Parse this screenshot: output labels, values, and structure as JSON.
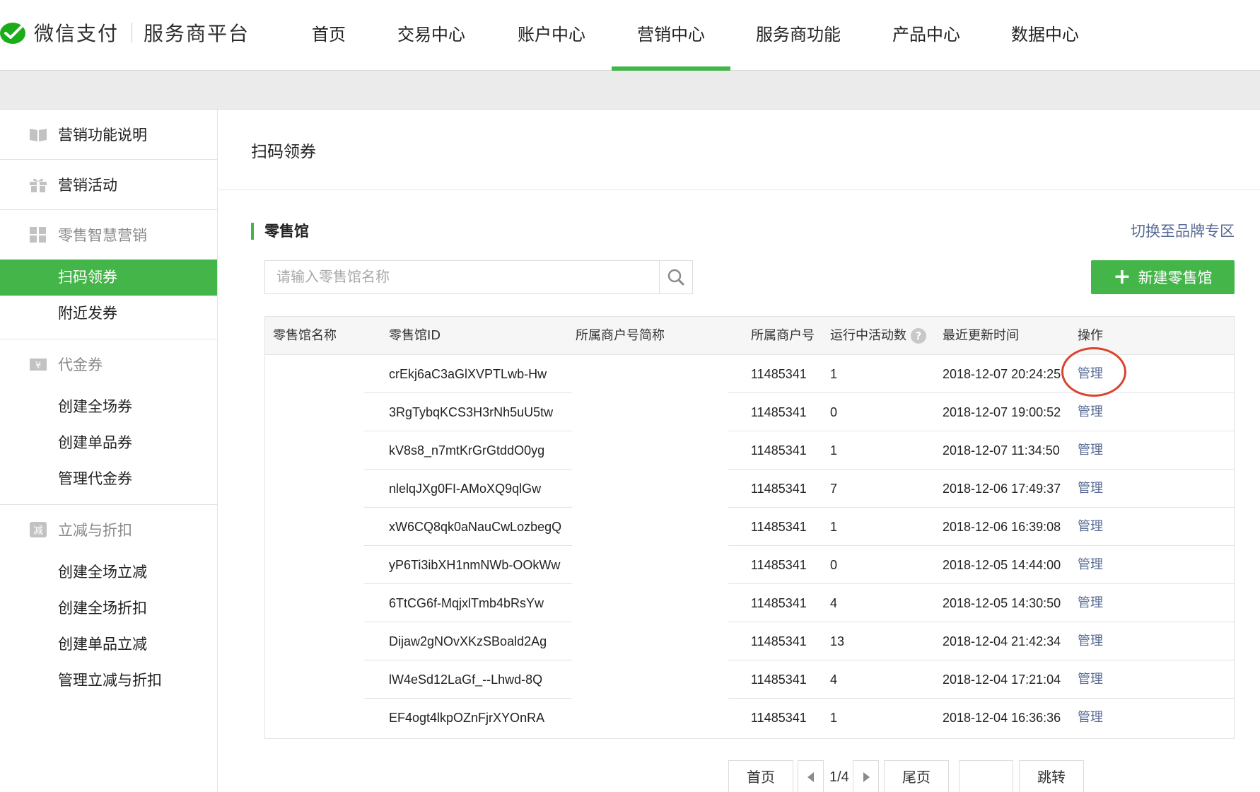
{
  "header": {
    "brand": "微信支付",
    "subtitle": "服务商平台",
    "nav": [
      {
        "label": "首页",
        "active": false
      },
      {
        "label": "交易中心",
        "active": false
      },
      {
        "label": "账户中心",
        "active": false
      },
      {
        "label": "营销中心",
        "active": true
      },
      {
        "label": "服务商功能",
        "active": false
      },
      {
        "label": "产品中心",
        "active": false
      },
      {
        "label": "数据中心",
        "active": false
      }
    ]
  },
  "sidebar": {
    "groups": [
      {
        "label": "营销功能说明",
        "icon": "book-icon",
        "muted": false,
        "items": []
      },
      {
        "label": "营销活动",
        "icon": "gift-icon",
        "muted": false,
        "items": []
      },
      {
        "label": "零售智慧营销",
        "icon": "grid-icon",
        "muted": true,
        "items": [
          {
            "label": "扫码领券",
            "active": true
          },
          {
            "label": "附近发券",
            "active": false
          }
        ]
      },
      {
        "label": "代金券",
        "icon": "yen-coupon-icon",
        "muted": true,
        "items": [
          {
            "label": "创建全场券",
            "active": false
          },
          {
            "label": "创建单品券",
            "active": false
          },
          {
            "label": "管理代金券",
            "active": false
          }
        ]
      },
      {
        "label": "立减与折扣",
        "icon": "discount-icon",
        "muted": true,
        "items": [
          {
            "label": "创建全场立减",
            "active": false
          },
          {
            "label": "创建全场折扣",
            "active": false
          },
          {
            "label": "创建单品立减",
            "active": false
          },
          {
            "label": "管理立减与折扣",
            "active": false
          }
        ]
      }
    ]
  },
  "main": {
    "page_title": "扫码领券",
    "section_title": "零售馆",
    "brand_switch_link": "切换至品牌专区",
    "search": {
      "placeholder": "请输入零售馆名称",
      "value": ""
    },
    "new_button": {
      "plus": "+",
      "label": "新建零售馆"
    },
    "table": {
      "columns": [
        "零售馆名称",
        "零售馆ID",
        "所属商户号简称",
        "所属商户号",
        "运行中活动数",
        "最近更新时间",
        "操作"
      ],
      "help_glyph": "?",
      "rows": [
        {
          "name": "",
          "id": "crEkj6aC3aGlXVPTLwb-Hw",
          "merchant_short": "",
          "merchant_no": "11485341",
          "active_count": "1",
          "updated": "2018-12-07 20:24:25",
          "action": "管理"
        },
        {
          "name": "",
          "id": "3RgTybqKCS3H3rNh5uU5tw",
          "merchant_short": "",
          "merchant_no": "11485341",
          "active_count": "0",
          "updated": "2018-12-07 19:00:52",
          "action": "管理"
        },
        {
          "name": "",
          "id": "kV8s8_n7mtKrGrGtddO0yg",
          "merchant_short": "",
          "merchant_no": "11485341",
          "active_count": "1",
          "updated": "2018-12-07 11:34:50",
          "action": "管理"
        },
        {
          "name": "",
          "id": "nlelqJXg0FI-AMoXQ9qlGw",
          "merchant_short": "",
          "merchant_no": "11485341",
          "active_count": "7",
          "updated": "2018-12-06 17:49:37",
          "action": "管理"
        },
        {
          "name": "",
          "id": "xW6CQ8qk0aNauCwLozbegQ",
          "merchant_short": "",
          "merchant_no": "11485341",
          "active_count": "1",
          "updated": "2018-12-06 16:39:08",
          "action": "管理"
        },
        {
          "name": "",
          "id": "yP6Ti3ibXH1nmNWb-OOkWw",
          "merchant_short": "",
          "merchant_no": "11485341",
          "active_count": "0",
          "updated": "2018-12-05 14:44:00",
          "action": "管理"
        },
        {
          "name": "",
          "id": "6TtCG6f-MqjxlTmb4bRsYw",
          "merchant_short": "",
          "merchant_no": "11485341",
          "active_count": "4",
          "updated": "2018-12-05 14:30:50",
          "action": "管理"
        },
        {
          "name": "",
          "id": "Dijaw2gNOvXKzSBoald2Ag",
          "merchant_short": "",
          "merchant_no": "11485341",
          "active_count": "13",
          "updated": "2018-12-04 21:42:34",
          "action": "管理"
        },
        {
          "name": "",
          "id": "lW4eSd12LaGf_--Lhwd-8Q",
          "merchant_short": "",
          "merchant_no": "11485341",
          "active_count": "4",
          "updated": "2018-12-04 17:21:04",
          "action": "管理"
        },
        {
          "name": "",
          "id": "EF4ogt4lkpOZnFjrXYOnRA",
          "merchant_short": "",
          "merchant_no": "11485341",
          "active_count": "1",
          "updated": "2018-12-04 16:36:36",
          "action": "管理"
        }
      ]
    },
    "pagination": {
      "first": "首页",
      "indicator": "1/4",
      "last": "尾页",
      "jump_value": "",
      "jump": "跳转"
    }
  },
  "colors": {
    "accent_green": "#44b549",
    "link_blue": "#576b95",
    "annotation_red": "#d9442f"
  }
}
